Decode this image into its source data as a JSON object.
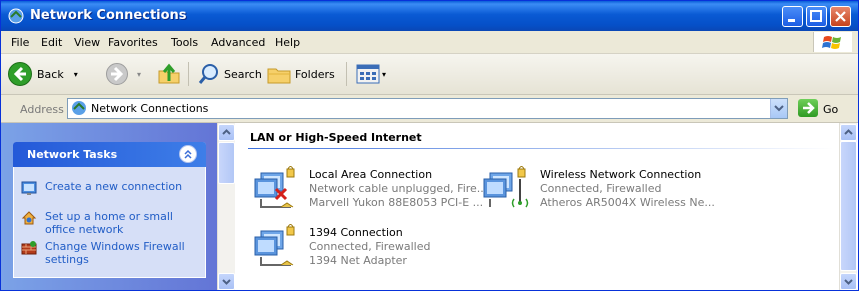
{
  "window": {
    "title": "Network Connections"
  },
  "menu": {
    "items": [
      {
        "label": "File"
      },
      {
        "label": "Edit"
      },
      {
        "label": "View"
      },
      {
        "label": "Favorites"
      },
      {
        "label": "Tools"
      },
      {
        "label": "Advanced"
      },
      {
        "label": "Help"
      }
    ]
  },
  "toolbar": {
    "back_label": "Back",
    "search_label": "Search",
    "folders_label": "Folders"
  },
  "address": {
    "label": "Address",
    "value": "Network Connections",
    "go_label": "Go"
  },
  "tasks": {
    "title": "Network Tasks",
    "items": [
      {
        "label": "Create a new connection"
      },
      {
        "label": "Set up a home or small office network"
      },
      {
        "label": "Change Windows Firewall settings"
      }
    ]
  },
  "group": {
    "title": "LAN or High-Speed Internet"
  },
  "connections": [
    {
      "name": "Local Area Connection",
      "status": "Network cable unplugged, Fire...",
      "device": "Marvell Yukon 88E8053 PCI-E ..."
    },
    {
      "name": "Wireless Network Connection",
      "status": "Connected, Firewalled",
      "device": "Atheros AR5004X Wireless Ne..."
    },
    {
      "name": "1394 Connection",
      "status": "Connected, Firewalled",
      "device": "1394 Net Adapter"
    }
  ],
  "colors": {
    "titlebar": "#0a5ad4",
    "task_link": "#215dc6",
    "task_pane": "#6375d6"
  }
}
